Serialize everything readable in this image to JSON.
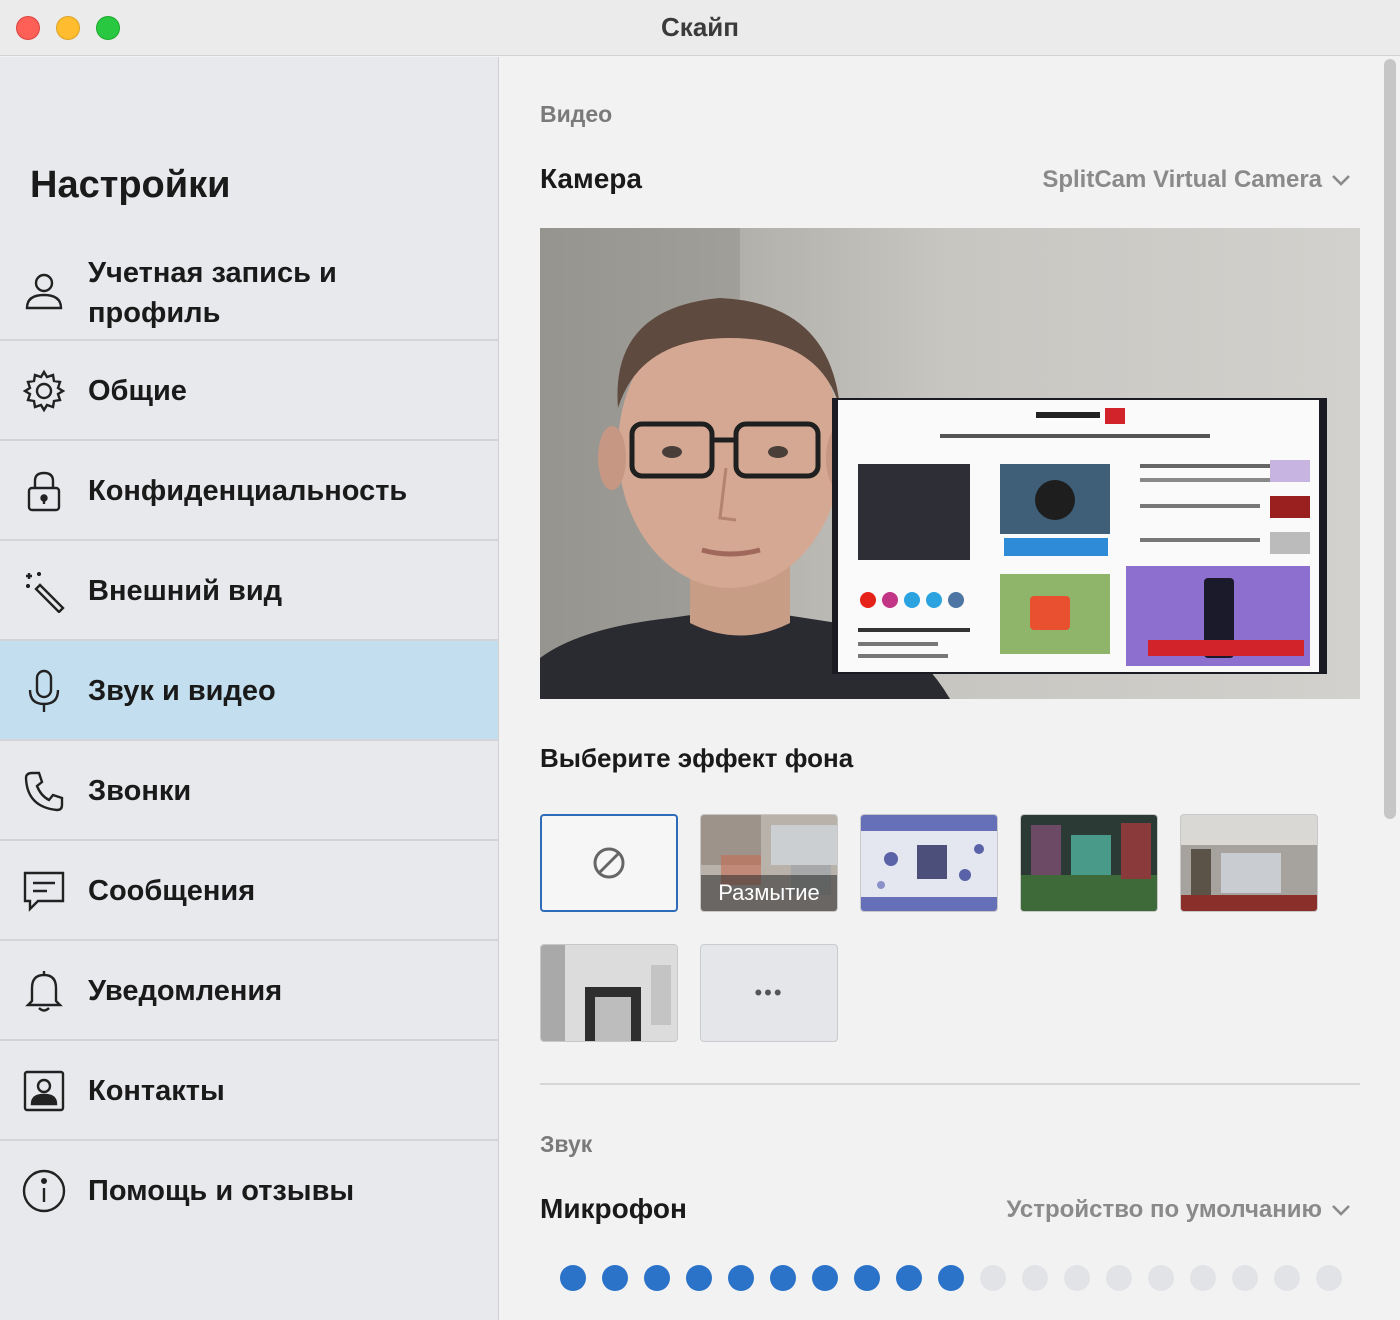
{
  "window": {
    "title": "Скайп"
  },
  "sidebar": {
    "title": "Настройки",
    "items": [
      {
        "label": "Учетная запись и профиль",
        "icon": "user-icon"
      },
      {
        "label": "Общие",
        "icon": "gear-icon"
      },
      {
        "label": "Конфиденциальность",
        "icon": "lock-icon"
      },
      {
        "label": "Внешний вид",
        "icon": "magic-wand-icon"
      },
      {
        "label": "Звук и видео",
        "icon": "microphone-icon",
        "active": true
      },
      {
        "label": "Звонки",
        "icon": "phone-icon"
      },
      {
        "label": "Сообщения",
        "icon": "message-icon"
      },
      {
        "label": "Уведомления",
        "icon": "bell-icon"
      },
      {
        "label": "Контакты",
        "icon": "contacts-icon"
      },
      {
        "label": "Помощь и отзывы",
        "icon": "info-icon"
      }
    ]
  },
  "video": {
    "section_title": "Видео",
    "camera_label": "Камера",
    "camera_value": "SplitCam Virtual Camera",
    "background_label": "Выберите эффект фона",
    "effects": [
      {
        "name": "none",
        "label": ""
      },
      {
        "name": "blur",
        "label": "Размытие"
      },
      {
        "name": "image-1",
        "label": ""
      },
      {
        "name": "image-2",
        "label": ""
      },
      {
        "name": "image-3",
        "label": ""
      },
      {
        "name": "image-4",
        "label": ""
      },
      {
        "name": "more",
        "label": "•••"
      }
    ]
  },
  "audio": {
    "section_title": "Звук",
    "mic_label": "Микрофон",
    "mic_value": "Устройство по умолчанию",
    "mic_level": {
      "active": 10,
      "total": 19
    }
  },
  "colors": {
    "accent": "#2a73c9",
    "active_nav": "#c3dfef"
  }
}
